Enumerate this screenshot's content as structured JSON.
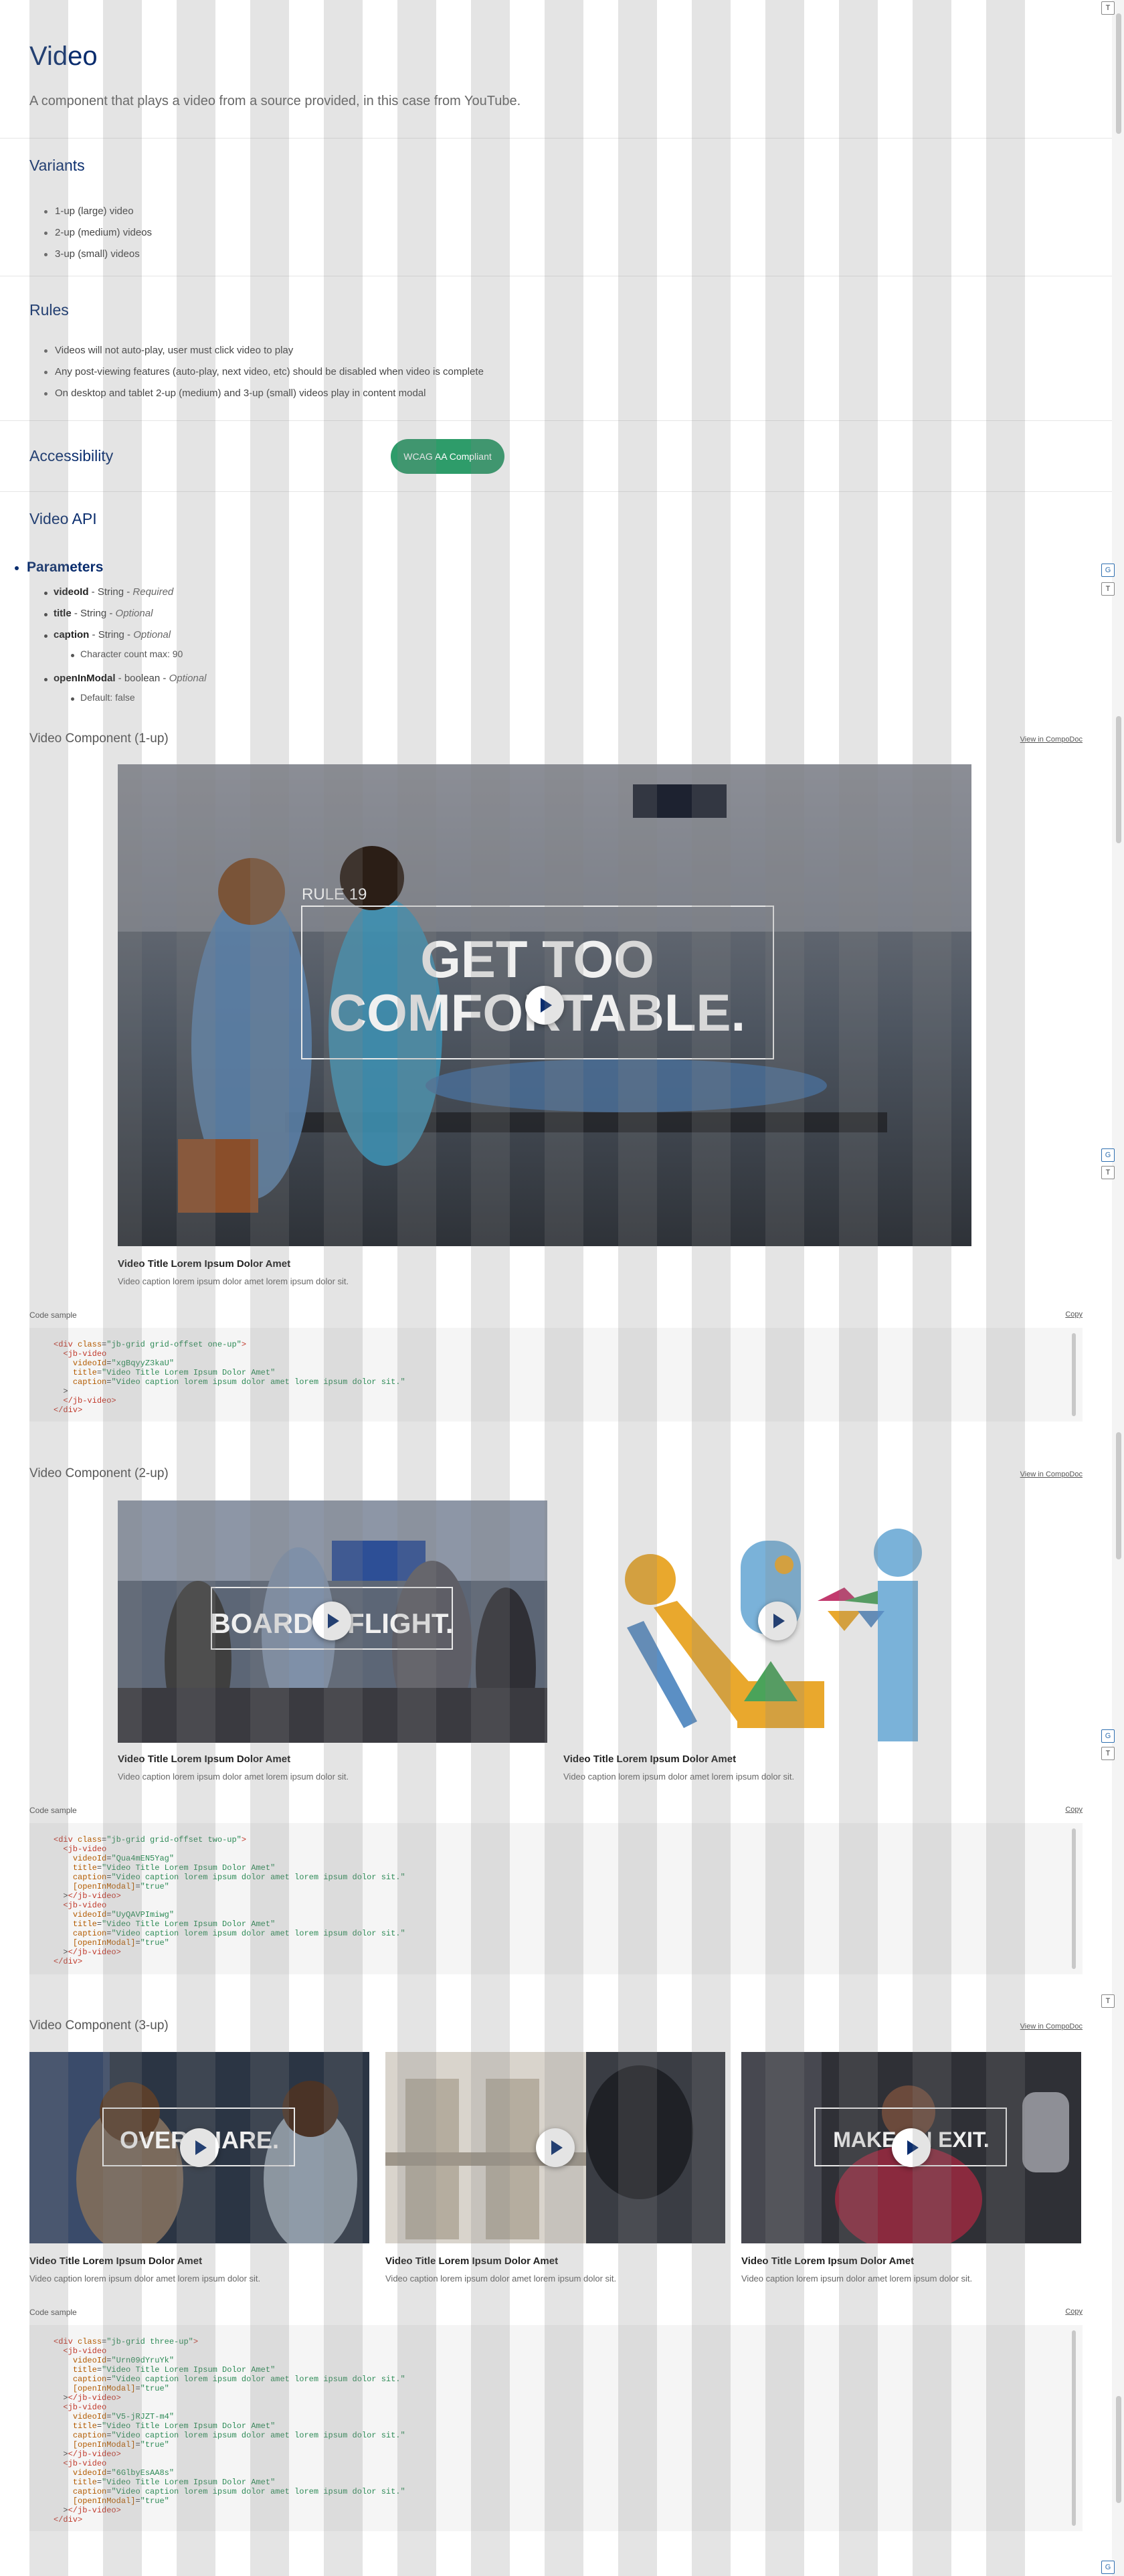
{
  "title": "Video",
  "subtitle": "A component that plays a video from a source provided, in this case from YouTube.",
  "variants": {
    "heading": "Variants",
    "items": [
      "1-up (large) video",
      "2-up (medium) videos",
      "3-up (small) videos"
    ]
  },
  "rules": {
    "heading": "Rules",
    "items": [
      "Videos will not auto-play, user must click video to play",
      "Any post-viewing features (auto-play, next video, etc) should be disabled when video is complete",
      "On desktop and tablet 2-up (medium) and 3-up (small) videos play in content modal"
    ]
  },
  "accessibility": {
    "heading": "Accessibility",
    "badge": "WCAG AA Compliant",
    "badge_color": "#2e9c6a"
  },
  "api": {
    "heading": "Video API",
    "params_heading": "Parameters",
    "params": [
      {
        "name": "videoId",
        "type": "String",
        "req": "Required"
      },
      {
        "name": "title",
        "type": "String",
        "req": "Optional"
      },
      {
        "name": "caption",
        "type": "String",
        "req": "Optional",
        "note": "Character count max: 90"
      },
      {
        "name": "openInModal",
        "type": "boolean",
        "req": "Optional",
        "note": "Default: false"
      }
    ]
  },
  "one_up": {
    "heading": "Video Component (1-up)",
    "compodoc": "View in CompoDoc",
    "thumb_kicker": "RULE 19",
    "thumb_line1": "GET TOO",
    "thumb_line2": "COMFORTABLE.",
    "video_title": "Video Title Lorem Ipsum Dolor Amet",
    "video_caption": "Video caption lorem ipsum dolor amet lorem ipsum dolor sit.",
    "code_label": "Code sample",
    "copy": "Copy"
  },
  "two_up": {
    "heading": "Video Component (2-up)",
    "compodoc": "View in CompoDoc",
    "thumb1_text": "BOARD A FLIGHT.",
    "video1_title": "Video Title Lorem Ipsum Dolor Amet",
    "video1_caption": "Video caption lorem ipsum dolor amet lorem ipsum dolor sit.",
    "video2_title": "Video Title Lorem Ipsum Dolor Amet",
    "video2_caption": "Video caption lorem ipsum dolor amet lorem ipsum dolor sit.",
    "code_label": "Code sample",
    "copy": "Copy"
  },
  "three_up": {
    "heading": "Video Component (3-up)",
    "compodoc": "View in CompoDoc",
    "thumb1_text": "OVERSHARE.",
    "thumb3_text": "MAKE AN EXIT.",
    "video1_title": "Video Title Lorem Ipsum Dolor Amet",
    "video1_caption": "Video caption lorem ipsum dolor amet lorem ipsum dolor sit.",
    "video2_title": "Video Title Lorem Ipsum Dolor Amet",
    "video2_caption": "Video caption lorem ipsum dolor amet lorem ipsum dolor sit.",
    "video3_title": "Video Title Lorem Ipsum Dolor Amet",
    "video3_caption": "Video caption lorem ipsum dolor amet lorem ipsum dolor sit.",
    "code_label": "Code sample",
    "copy": "Copy"
  },
  "code_samples": {
    "one_up": [
      {
        "t": "tg",
        "s": "<div "
      },
      {
        "t": "at",
        "s": "class"
      },
      {
        "t": "",
        "s": "="
      },
      {
        "t": "st",
        "s": "\"jb-grid grid-offset one-up\""
      },
      {
        "t": "tg",
        "s": ">"
      },
      {
        "t": "",
        "s": "\n  "
      },
      {
        "t": "tg",
        "s": "<jb-video"
      },
      {
        "t": "",
        "s": "\n    "
      },
      {
        "t": "at",
        "s": "videoId"
      },
      {
        "t": "",
        "s": "="
      },
      {
        "t": "st",
        "s": "\"xgBqyyZ3kaU\""
      },
      {
        "t": "",
        "s": "\n    "
      },
      {
        "t": "at",
        "s": "title"
      },
      {
        "t": "",
        "s": "="
      },
      {
        "t": "st",
        "s": "\"Video Title Lorem Ipsum Dolor Amet\""
      },
      {
        "t": "",
        "s": "\n    "
      },
      {
        "t": "at",
        "s": "caption"
      },
      {
        "t": "",
        "s": "="
      },
      {
        "t": "st",
        "s": "\"Video caption lorem ipsum dolor amet lorem ipsum dolor sit.\""
      },
      {
        "t": "",
        "s": "\n  >\n  "
      },
      {
        "t": "tg",
        "s": "</jb-video>"
      },
      {
        "t": "",
        "s": "\n"
      },
      {
        "t": "tg",
        "s": "</div>"
      }
    ],
    "two_up": [
      {
        "t": "tg",
        "s": "<div "
      },
      {
        "t": "at",
        "s": "class"
      },
      {
        "t": "",
        "s": "="
      },
      {
        "t": "st",
        "s": "\"jb-grid grid-offset two-up\""
      },
      {
        "t": "tg",
        "s": ">"
      },
      {
        "t": "",
        "s": "\n  "
      },
      {
        "t": "tg",
        "s": "<jb-video"
      },
      {
        "t": "",
        "s": "\n    "
      },
      {
        "t": "at",
        "s": "videoId"
      },
      {
        "t": "",
        "s": "="
      },
      {
        "t": "st",
        "s": "\"Qua4mEN5Yag\""
      },
      {
        "t": "",
        "s": "\n    "
      },
      {
        "t": "at",
        "s": "title"
      },
      {
        "t": "",
        "s": "="
      },
      {
        "t": "st",
        "s": "\"Video Title Lorem Ipsum Dolor Amet\""
      },
      {
        "t": "",
        "s": "\n    "
      },
      {
        "t": "at",
        "s": "caption"
      },
      {
        "t": "",
        "s": "="
      },
      {
        "t": "st",
        "s": "\"Video caption lorem ipsum dolor amet lorem ipsum dolor sit.\""
      },
      {
        "t": "",
        "s": "\n    "
      },
      {
        "t": "at",
        "s": "[openInModal]"
      },
      {
        "t": "",
        "s": "="
      },
      {
        "t": "st",
        "s": "\"true\""
      },
      {
        "t": "",
        "s": "\n  >"
      },
      {
        "t": "tg",
        "s": "</jb-video>"
      },
      {
        "t": "",
        "s": "\n  "
      },
      {
        "t": "tg",
        "s": "<jb-video"
      },
      {
        "t": "",
        "s": "\n    "
      },
      {
        "t": "at",
        "s": "videoId"
      },
      {
        "t": "",
        "s": "="
      },
      {
        "t": "st",
        "s": "\"UyQAVPImiwg\""
      },
      {
        "t": "",
        "s": "\n    "
      },
      {
        "t": "at",
        "s": "title"
      },
      {
        "t": "",
        "s": "="
      },
      {
        "t": "st",
        "s": "\"Video Title Lorem Ipsum Dolor Amet\""
      },
      {
        "t": "",
        "s": "\n    "
      },
      {
        "t": "at",
        "s": "caption"
      },
      {
        "t": "",
        "s": "="
      },
      {
        "t": "st",
        "s": "\"Video caption lorem ipsum dolor amet lorem ipsum dolor sit.\""
      },
      {
        "t": "",
        "s": "\n    "
      },
      {
        "t": "at",
        "s": "[openInModal]"
      },
      {
        "t": "",
        "s": "="
      },
      {
        "t": "st",
        "s": "\"true\""
      },
      {
        "t": "",
        "s": "\n  >"
      },
      {
        "t": "tg",
        "s": "</jb-video>"
      },
      {
        "t": "",
        "s": "\n"
      },
      {
        "t": "tg",
        "s": "</div>"
      }
    ],
    "three_up": [
      {
        "t": "tg",
        "s": "<div "
      },
      {
        "t": "at",
        "s": "class"
      },
      {
        "t": "",
        "s": "="
      },
      {
        "t": "st",
        "s": "\"jb-grid three-up\""
      },
      {
        "t": "tg",
        "s": ">"
      },
      {
        "t": "",
        "s": "\n  "
      },
      {
        "t": "tg",
        "s": "<jb-video"
      },
      {
        "t": "",
        "s": "\n    "
      },
      {
        "t": "at",
        "s": "videoId"
      },
      {
        "t": "",
        "s": "="
      },
      {
        "t": "st",
        "s": "\"Urn09dYruYk\""
      },
      {
        "t": "",
        "s": "\n    "
      },
      {
        "t": "at",
        "s": "title"
      },
      {
        "t": "",
        "s": "="
      },
      {
        "t": "st",
        "s": "\"Video Title Lorem Ipsum Dolor Amet\""
      },
      {
        "t": "",
        "s": "\n    "
      },
      {
        "t": "at",
        "s": "caption"
      },
      {
        "t": "",
        "s": "="
      },
      {
        "t": "st",
        "s": "\"Video caption lorem ipsum dolor amet lorem ipsum dolor sit.\""
      },
      {
        "t": "",
        "s": "\n    "
      },
      {
        "t": "at",
        "s": "[openInModal]"
      },
      {
        "t": "",
        "s": "="
      },
      {
        "t": "st",
        "s": "\"true\""
      },
      {
        "t": "",
        "s": "\n  >"
      },
      {
        "t": "tg",
        "s": "</jb-video>"
      },
      {
        "t": "",
        "s": "\n  "
      },
      {
        "t": "tg",
        "s": "<jb-video"
      },
      {
        "t": "",
        "s": "\n    "
      },
      {
        "t": "at",
        "s": "videoId"
      },
      {
        "t": "",
        "s": "="
      },
      {
        "t": "st",
        "s": "\"V5-jRJZT-m4\""
      },
      {
        "t": "",
        "s": "\n    "
      },
      {
        "t": "at",
        "s": "title"
      },
      {
        "t": "",
        "s": "="
      },
      {
        "t": "st",
        "s": "\"Video Title Lorem Ipsum Dolor Amet\""
      },
      {
        "t": "",
        "s": "\n    "
      },
      {
        "t": "at",
        "s": "caption"
      },
      {
        "t": "",
        "s": "="
      },
      {
        "t": "st",
        "s": "\"Video caption lorem ipsum dolor amet lorem ipsum dolor sit.\""
      },
      {
        "t": "",
        "s": "\n    "
      },
      {
        "t": "at",
        "s": "[openInModal]"
      },
      {
        "t": "",
        "s": "="
      },
      {
        "t": "st",
        "s": "\"true\""
      },
      {
        "t": "",
        "s": "\n  >"
      },
      {
        "t": "tg",
        "s": "</jb-video>"
      },
      {
        "t": "",
        "s": "\n  "
      },
      {
        "t": "tg",
        "s": "<jb-video"
      },
      {
        "t": "",
        "s": "\n    "
      },
      {
        "t": "at",
        "s": "videoId"
      },
      {
        "t": "",
        "s": "="
      },
      {
        "t": "st",
        "s": "\"6GlbyEsAA8s\""
      },
      {
        "t": "",
        "s": "\n    "
      },
      {
        "t": "at",
        "s": "title"
      },
      {
        "t": "",
        "s": "="
      },
      {
        "t": "st",
        "s": "\"Video Title Lorem Ipsum Dolor Amet\""
      },
      {
        "t": "",
        "s": "\n    "
      },
      {
        "t": "at",
        "s": "caption"
      },
      {
        "t": "",
        "s": "="
      },
      {
        "t": "st",
        "s": "\"Video caption lorem ipsum dolor amet lorem ipsum dolor sit.\""
      },
      {
        "t": "",
        "s": "\n    "
      },
      {
        "t": "at",
        "s": "[openInModal]"
      },
      {
        "t": "",
        "s": "="
      },
      {
        "t": "st",
        "s": "\"true\""
      },
      {
        "t": "",
        "s": "\n  >"
      },
      {
        "t": "tg",
        "s": "</jb-video>"
      },
      {
        "t": "",
        "s": "\n"
      },
      {
        "t": "tg",
        "s": "</div>"
      }
    ]
  },
  "side_buttons": {
    "g": "G",
    "t": "T"
  },
  "colors": {
    "heading": "#0a2d6e",
    "accent_green": "#2e9c6a"
  }
}
